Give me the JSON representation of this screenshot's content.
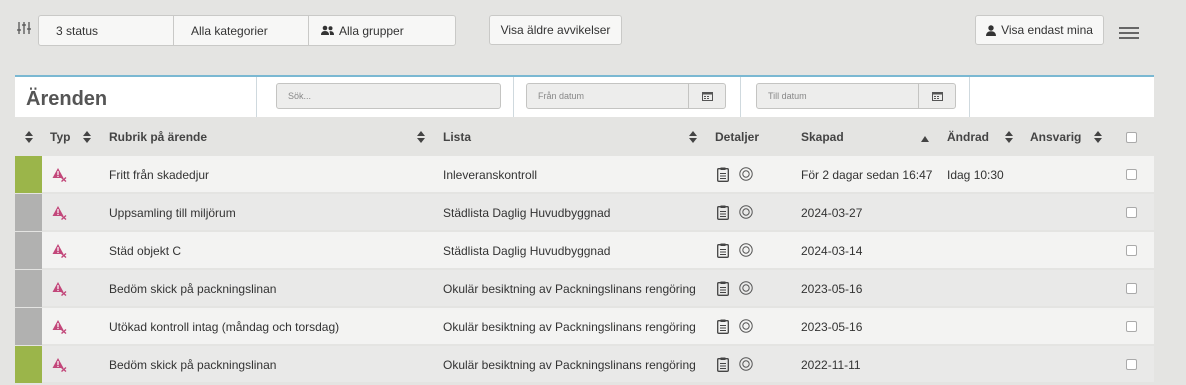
{
  "toolbar": {
    "status_filter": "3 status",
    "category_filter": "Alla kategorier",
    "group_filter": "Alla grupper",
    "older_button": "Visa äldre avvikelser",
    "mine_button": "Visa endast mina"
  },
  "header": {
    "title": "Ärenden",
    "search_placeholder": "Sök...",
    "from_date_placeholder": "Från datum",
    "to_date_placeholder": "Till datum"
  },
  "table": {
    "columns": {
      "type": "Typ",
      "title": "Rubrik på ärende",
      "list": "Lista",
      "details": "Detaljer",
      "created": "Skapad",
      "changed": "Ändrad",
      "responsible": "Ansvarig"
    },
    "rows": [
      {
        "status": "green",
        "title": "Fritt från skadedjur",
        "list": "Inleveranskontroll",
        "created": "För 2 dagar sedan 16:47",
        "changed": "Idag 10:30"
      },
      {
        "status": "gray",
        "title": "Uppsamling till miljörum",
        "list": "Städlista Daglig Huvudbyggnad",
        "created": "2024-03-27",
        "changed": ""
      },
      {
        "status": "gray",
        "title": "Städ objekt C",
        "list": "Städlista Daglig Huvudbyggnad",
        "created": "2024-03-14",
        "changed": ""
      },
      {
        "status": "gray",
        "title": "Bedöm skick på packningslinan",
        "list": "Okulär besiktning av Packningslinans rengöring",
        "created": "2023-05-16",
        "changed": ""
      },
      {
        "status": "gray",
        "title": "Utökad kontroll intag (måndag och torsdag)",
        "list": "Okulär besiktning av Packningslinans rengöring",
        "created": "2023-05-16",
        "changed": ""
      },
      {
        "status": "green",
        "title": "Bedöm skick på packningslinan",
        "list": "Okulär besiktning av Packningslinans rengöring",
        "created": "2022-11-11",
        "changed": ""
      }
    ]
  },
  "colors": {
    "green": "#9bb54a",
    "gray": "#b1b1b0",
    "accent": "#7ab8d2",
    "type_icon": "#c2477a"
  }
}
